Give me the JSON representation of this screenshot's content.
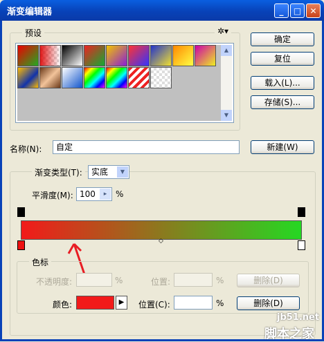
{
  "window": {
    "title": "渐变编辑器"
  },
  "presets": {
    "label": "预设",
    "menu_icon": "gear-icon"
  },
  "buttons": {
    "ok": "确定",
    "reset": "复位",
    "load": "载入(L)...",
    "save": "存储(S)...",
    "new": "新建(W)",
    "delete": "删除(D)"
  },
  "name": {
    "label": "名称(N):",
    "value": "自定"
  },
  "gradient": {
    "type_label": "渐变类型(T):",
    "type_value": "实底",
    "smoothness_label": "平滑度(M):",
    "smoothness_value": "100",
    "percent": "%",
    "colors": {
      "start": "#f21a1a",
      "end": "#25d822"
    }
  },
  "stops": {
    "group_label": "色标",
    "opacity_label": "不透明度:",
    "opacity_percent": "%",
    "location_label": "位置:",
    "location_percent": "%",
    "color_label": "颜色:",
    "color_value": "#f21a1a",
    "location2_label": "位置(C):",
    "location2_value": "",
    "location2_percent": "%"
  },
  "watermark": {
    "site": "jb51.net",
    "text": "脚本之家"
  }
}
